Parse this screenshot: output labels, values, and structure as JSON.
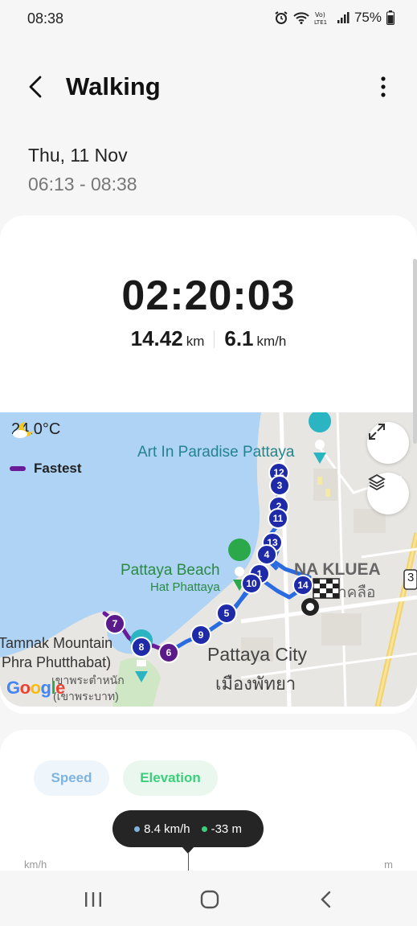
{
  "status_bar": {
    "time": "08:38",
    "battery": "75%",
    "network": "LTE1",
    "icons": [
      "alarm-icon",
      "wifi-icon",
      "volte-icon",
      "signal-icon",
      "battery-icon"
    ]
  },
  "header": {
    "title": "Walking",
    "back_icon": "back-arrow-icon",
    "more_icon": "more-vert-icon"
  },
  "session": {
    "date": "Thu, 11 Nov",
    "time_range": "06:13 - 08:38"
  },
  "summary": {
    "duration": "02:20:03",
    "distance_value": "14.42",
    "distance_unit": "km",
    "speed_value": "6.1",
    "speed_unit": "km/h"
  },
  "map": {
    "weather_icon": "partly-cloudy-night-icon",
    "temperature": "24.0°C",
    "legend_label": "Fastest",
    "legend_color": "#6a1b9a",
    "route_color": "#2a6be0",
    "marker_color": "#1e2aa8",
    "fast_marker_color": "#5b1a8a",
    "places": {
      "art_in_paradise": "Art In Paradise Pattaya",
      "pattaya_beach": "Pattaya Beach",
      "hat_phattaya": "Hat Phattaya",
      "na_kluea": "NA KLUEA",
      "na_kluea_thai": "าคลือ",
      "pattaya_city": "Pattaya City",
      "pattaya_city_thai": "เมืองพัทยา",
      "tamnak_mountain": "Tamnak Mountain",
      "phra_phutthabat": "Phra Phutthabat)",
      "thai_line1": "เขาพระตำหนัก",
      "thai_line2": "(เขาพระบาท)",
      "road_number": "3"
    },
    "markers": [
      "12",
      "3",
      "2",
      "11",
      "13",
      "4",
      "1",
      "10",
      "14",
      "5",
      "9",
      "6",
      "8",
      "7"
    ],
    "google_logo": "Google",
    "expand_icon": "expand-icon",
    "layers_icon": "layers-icon"
  },
  "chart": {
    "tab_speed": "Speed",
    "tab_elevation": "Elevation",
    "tooltip_speed": "8.4 km/h",
    "tooltip_elevation": "-33 m",
    "speed_color": "#7fb4e0",
    "elevation_color": "#3ccf7a",
    "left_axis_unit": "km/h",
    "right_axis_unit": "m"
  },
  "nav_bar": {
    "recents_icon": "recents-icon",
    "home_icon": "home-icon",
    "back_icon": "nav-back-icon"
  }
}
